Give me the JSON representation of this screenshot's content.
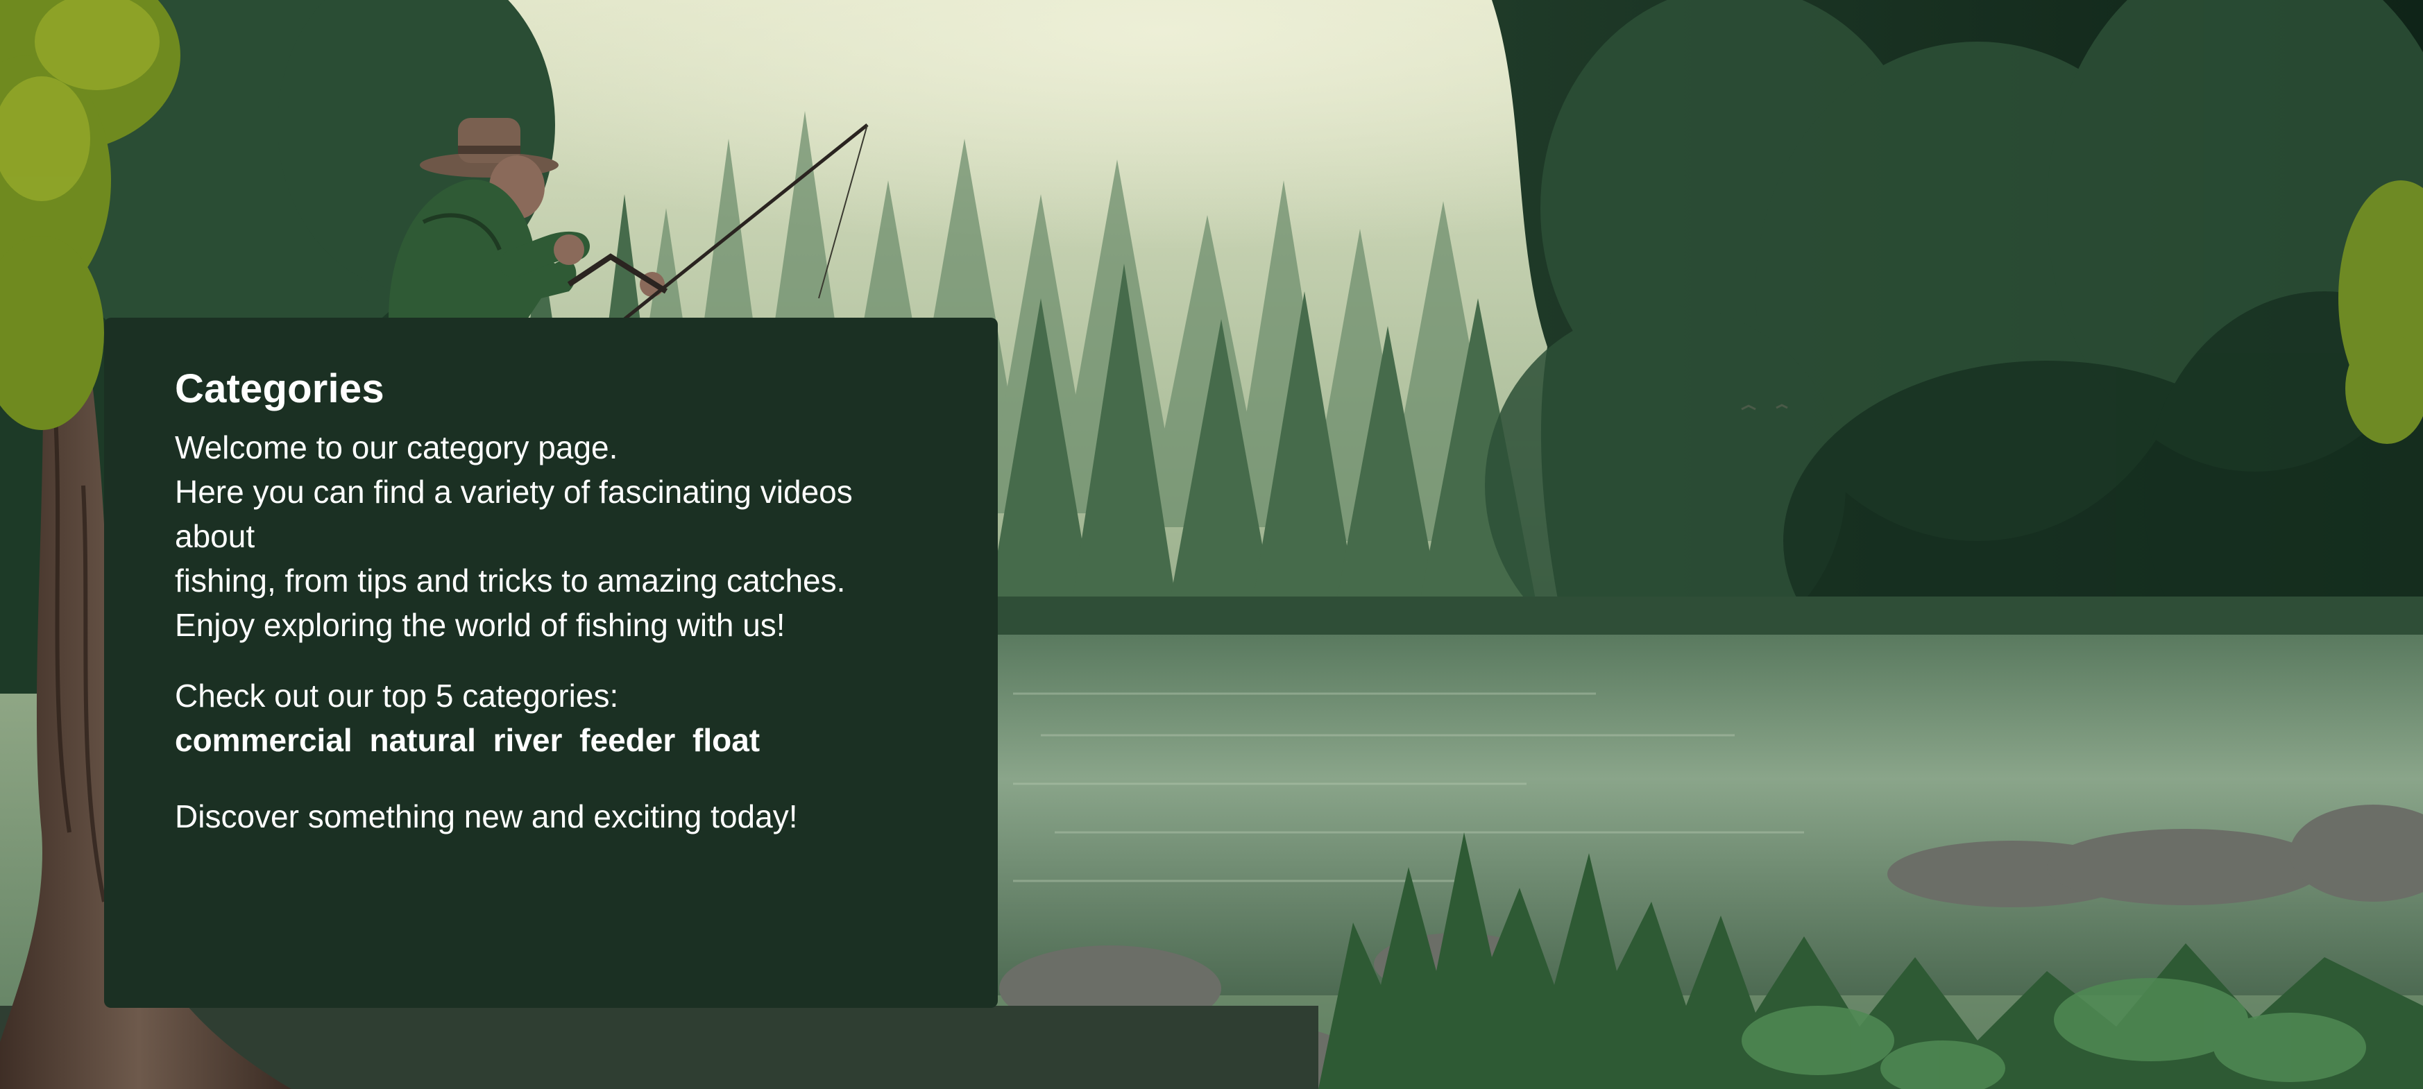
{
  "page": {
    "title": "Categories",
    "intro_lines": [
      "Welcome to our category page.",
      "Here you can find a variety of fascinating videos about",
      "fishing, from tips and tricks to amazing catches.",
      "Enjoy exploring the world of fishing with us!"
    ],
    "top_label": "Check out our top 5 categories:",
    "top_categories": [
      "commercial",
      "natural",
      "river",
      "feeder",
      "float"
    ],
    "outro": "Discover something new and exciting today!"
  },
  "colors": {
    "panel_background": "#1b3023",
    "panel_text": "#ffffff",
    "scene_fog": "#dfe4c9",
    "scene_forest": "#2e5a3c",
    "scene_water": "#7d9a80"
  },
  "background": {
    "scene": "misty forest lake with fisherman illustration"
  }
}
